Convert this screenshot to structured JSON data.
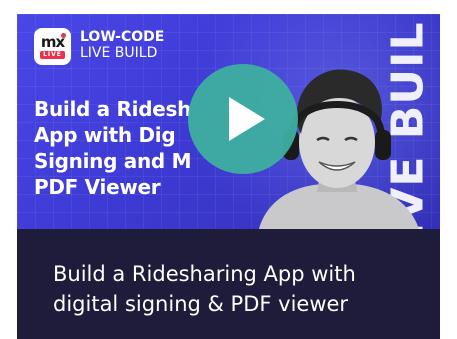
{
  "brand": {
    "logo_mark": "mx",
    "logo_badge": "LIVE",
    "line1": "LOW-CODE",
    "line2": "LIVE BUILD"
  },
  "thumbnail": {
    "headline_lines": [
      "Build a Ridesh",
      "App with Dig",
      "Signing and M",
      "PDF Viewer"
    ],
    "vertical_text": "LIVE BUILD",
    "colors": {
      "background": "#4a47e8",
      "play_button": "#3eafa0",
      "logo_accent": "#e9324d"
    },
    "icons": [
      "play-icon",
      "headphones-person-image"
    ]
  },
  "caption": {
    "lines": [
      "Build a Ridesharing App with",
      "digital signing & PDF viewer"
    ],
    "background": "#1f1b3a"
  }
}
